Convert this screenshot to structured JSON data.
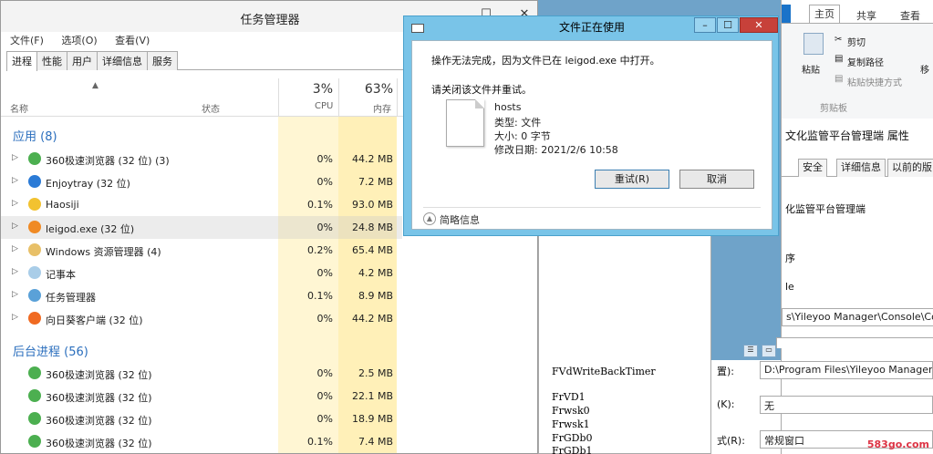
{
  "task_manager": {
    "title": "任务管理器",
    "menu": [
      "文件(F)",
      "选项(O)",
      "查看(V)"
    ],
    "tabs": [
      "进程",
      "性能",
      "用户",
      "详细信息",
      "服务"
    ],
    "columns": {
      "name": "名称",
      "status": "状态",
      "cpu_pct": "3%",
      "cpu": "CPU",
      "mem_pct": "63%",
      "mem": "内存"
    },
    "group_apps": "应用 (8)",
    "group_background": "后台进程 (56)",
    "apps": [
      {
        "name": "360极速浏览器 (32 位) (3)",
        "cpu": "0%",
        "mem": "44.2 MB",
        "icon": "browser-360-icon",
        "color": "#4caf50"
      },
      {
        "name": "Enjoytray (32 位)",
        "cpu": "0%",
        "mem": "7.2 MB",
        "icon": "monitor-icon",
        "color": "#2b7bd6"
      },
      {
        "name": "Haosiji",
        "cpu": "0.1%",
        "mem": "93.0 MB",
        "icon": "haosiji-icon",
        "color": "#f2c230"
      },
      {
        "name": "leigod.exe (32 位)",
        "cpu": "0%",
        "mem": "24.8 MB",
        "icon": "leigod-icon",
        "color": "#f08a24"
      },
      {
        "name": "Windows 资源管理器 (4)",
        "cpu": "0.2%",
        "mem": "65.4 MB",
        "icon": "folder-icon",
        "color": "#e8c068"
      },
      {
        "name": "记事本",
        "cpu": "0%",
        "mem": "4.2 MB",
        "icon": "notepad-icon",
        "color": "#a9cde8"
      },
      {
        "name": "任务管理器",
        "cpu": "0.1%",
        "mem": "8.9 MB",
        "icon": "task-manager-icon",
        "color": "#5aa1d8"
      },
      {
        "name": "向日葵客户端 (32 位)",
        "cpu": "0%",
        "mem": "44.2 MB",
        "icon": "sunflower-icon",
        "color": "#f06a22"
      }
    ],
    "background": [
      {
        "name": "360极速浏览器 (32 位)",
        "cpu": "0%",
        "mem": "2.5 MB",
        "icon": "browser-360-icon",
        "color": "#4caf50"
      },
      {
        "name": "360极速浏览器 (32 位)",
        "cpu": "0%",
        "mem": "22.1 MB",
        "icon": "browser-360-icon",
        "color": "#4caf50"
      },
      {
        "name": "360极速浏览器 (32 位)",
        "cpu": "0%",
        "mem": "18.9 MB",
        "icon": "browser-360-icon",
        "color": "#4caf50"
      },
      {
        "name": "360极速浏览器 (32 位)",
        "cpu": "0.1%",
        "mem": "7.4 MB",
        "icon": "browser-360-icon",
        "color": "#4caf50"
      }
    ]
  },
  "dialog": {
    "title": "文件正在使用",
    "message": "操作无法完成，因为文件已在 leigod.exe 中打开。",
    "instruction": "请关闭该文件并重试。",
    "file_name": "hosts",
    "file_type": "类型: 文件",
    "file_size": "大小: 0 字节",
    "file_modified": "修改日期: 2021/2/6 10:58",
    "retry": "重试(R)",
    "cancel": "取消",
    "details": "简略信息"
  },
  "console": {
    "lines": [
      "FVdWriteBackTimer",
      "FrVD1",
      "Frwsk0",
      "Frwsk1",
      "FrGDb0",
      "FrGDb1"
    ]
  },
  "explorer": {
    "tabs": [
      "主页",
      "共享",
      "查看"
    ],
    "paste": "粘贴",
    "cut": "剪切",
    "copy_path": "复制路径",
    "paste_shortcut": "粘贴快捷方式",
    "move": "移",
    "clipboard": "剪贴板"
  },
  "properties": {
    "title": "文化监管平台管理端 属性",
    "tabs": [
      "安全",
      "详细信息",
      "以前的版"
    ],
    "name": "化监管平台管理端",
    "program": "序",
    "console": "le",
    "target": "s\\Yileyoo Manager\\Console\\Co",
    "start_label": "置):",
    "start_in": "D:\\Program Files\\Yileyoo Manager\\",
    "shortcut_label": "(K):",
    "shortcut": "无",
    "run_label": "式(R):",
    "run": "常规窗口"
  },
  "watermark": "583go.com"
}
